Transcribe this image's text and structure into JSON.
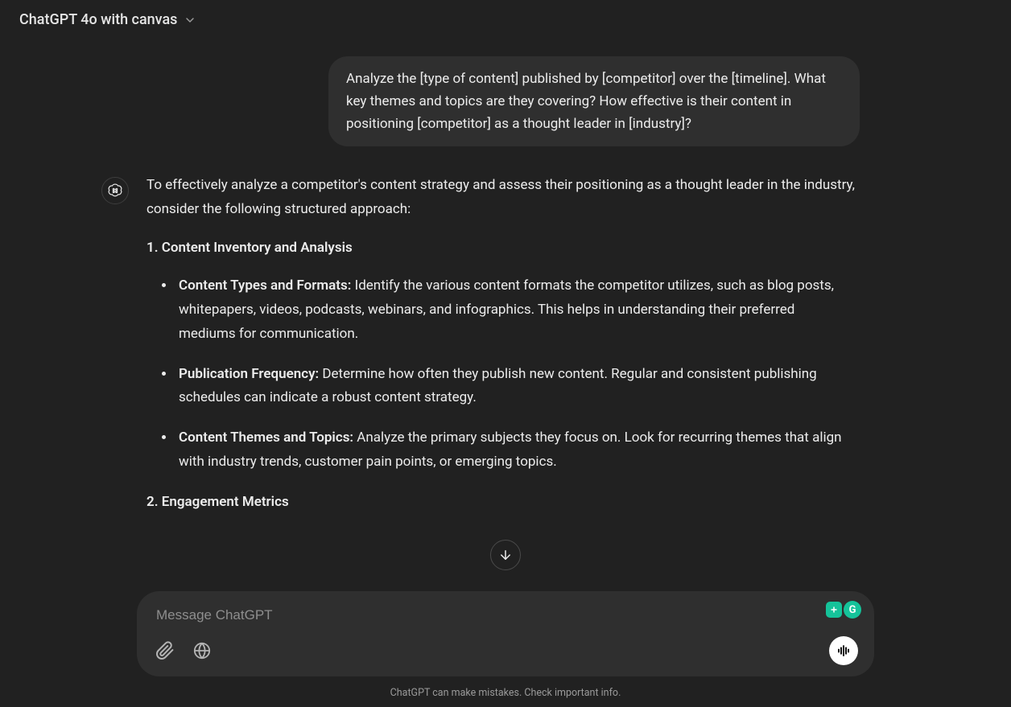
{
  "header": {
    "model_label": "ChatGPT 4o with canvas"
  },
  "conversation": {
    "user_message": "Analyze the [type of content] published by [competitor] over the [timeline]. What key themes and topics are they covering? How effective is their content in positioning [competitor] as a thought leader in [industry]?",
    "assistant": {
      "intro": "To effectively analyze a competitor's content strategy and assess their positioning as a thought leader in the industry, consider the following structured approach:",
      "section1_heading": "1. Content Inventory and Analysis",
      "section1_items": [
        {
          "label": "Content Types and Formats:",
          "text": " Identify the various content formats the competitor utilizes, such as blog posts, whitepapers, videos, podcasts, webinars, and infographics. This helps in understanding their preferred mediums for communication."
        },
        {
          "label": "Publication Frequency:",
          "text": " Determine how often they publish new content. Regular and consistent publishing schedules can indicate a robust content strategy."
        },
        {
          "label": "Content Themes and Topics:",
          "text": " Analyze the primary subjects they focus on. Look for recurring themes that align with industry trends, customer pain points, or emerging topics."
        }
      ],
      "section2_heading": "2. Engagement Metrics"
    }
  },
  "composer": {
    "placeholder": "Message ChatGPT"
  },
  "footer": {
    "disclaimer": "ChatGPT can make mistakes. Check important info."
  },
  "grammarly": {
    "letter": "G"
  }
}
